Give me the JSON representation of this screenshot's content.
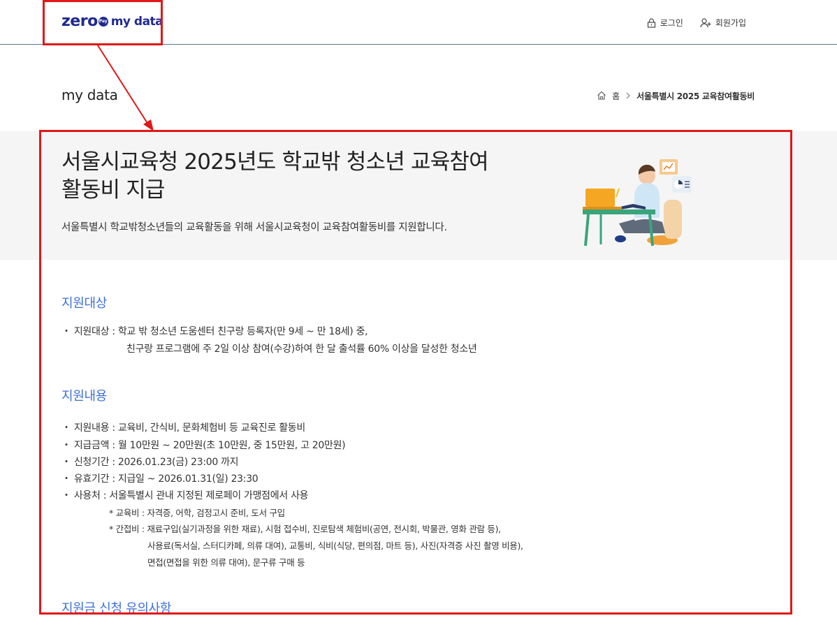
{
  "header": {
    "logo_main": "zero",
    "logo_badge": "Pay",
    "logo_sub": "my data",
    "login": "로그인",
    "signup": "회원가입"
  },
  "page": {
    "title": "my data",
    "breadcrumb_home": "홈",
    "breadcrumb_current": "서울특별시 2025 교육참여활동비"
  },
  "hero": {
    "title_line1": "서울시교육청 2025년도 학교밖 청소년 교육참여",
    "title_line2": "활동비 지급",
    "subtitle": "서울특별시 학교밖청소년들의 교육활동을 위해 서울시교육청이 교육참여활동비를 지원합니다."
  },
  "sections": {
    "target_title": "지원대상",
    "target_line1": "・ 지원대상 : 학교 밖 청소년 도움센터 친구랑 등록자(만 9세 ~ 만 18세) 중,",
    "target_line2": "친구랑 프로그램에 주 2일 이상 참여(수강)하여 한 달 출석률 60% 이상을 달성한 청소년",
    "content_title": "지원내용",
    "content_items": [
      "・ 지원내용 : 교육비, 간식비, 문화체험비 등 교육진로 활동비",
      "・ 지급금액 : 월 10만원 ~ 20만원(초 10만원, 중 15만원, 고 20만원)",
      "・ 신청기간 : 2026.01.23(금) 23:00 까지",
      "・ 유효기간 : 지급일 ~ 2026.01.31(일) 23:30",
      "・ 사용처 : 서울특별시 관내 지정된 제로페이 가맹점에서 사용"
    ],
    "sub_edu": "* 교육비 : 자격증, 어학, 검정고시 준비, 도서 구입",
    "sub_indirect1": "* 간접비 : 재료구입(실기과정을 위한 재료), 시험 접수비, 진로탐색 체험비(공연, 전시회, 박물관, 영화 관람 등),",
    "sub_indirect2": "사용료(독서실, 스터디카페, 의류 대여), 교통비, 식비(식당, 편의점, 마트 등), 사진(자격증 사진 촬영 비용),",
    "sub_indirect3": "면접(면접을 위한 의류 대여), 문구류 구매 등",
    "notice_title": "지원금 신청 유의사항"
  },
  "colors": {
    "brand": "#1f2a8f",
    "section_title": "#3d6fd9",
    "annotation": "#e01818",
    "hero_bg": "#f5f5f5"
  },
  "icons": [
    "lock-icon",
    "user-plus-icon",
    "home-icon",
    "chevron-right-icon"
  ]
}
